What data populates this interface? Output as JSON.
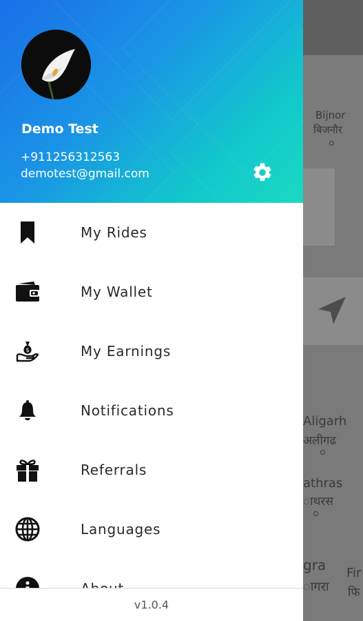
{
  "user": {
    "name": "Demo Test",
    "phone": "+911256312563",
    "email": "demotest@gmail.com"
  },
  "menu": {
    "items": [
      {
        "label": "My Rides",
        "icon": "bookmark-icon"
      },
      {
        "label": "My Wallet",
        "icon": "wallet-icon"
      },
      {
        "label": "My Earnings",
        "icon": "money-bag-hand-icon"
      },
      {
        "label": "Notifications",
        "icon": "bell-icon"
      },
      {
        "label": "Referrals",
        "icon": "gift-icon"
      },
      {
        "label": "Languages",
        "icon": "globe-icon"
      },
      {
        "label": "About",
        "icon": "info-icon"
      }
    ]
  },
  "footer": {
    "version": "v1.0.4"
  },
  "map": {
    "labels": {
      "bijnor_en": "Bijnor",
      "bijnor_hi": "बिजनौर",
      "aligarh_en": "Aligarh",
      "aligarh_hi": "अलीगढ",
      "hathras_en": "athras",
      "hathras_hi": "ाथरस",
      "agra_en": "gra",
      "agra_hi": "ागरा",
      "firozabad_en": "Fir",
      "firozabad_hi": "फि"
    }
  },
  "colors": {
    "header_gradient_start": "#1a6fe8",
    "header_gradient_end": "#1ad9c2",
    "overlay": "#6f6f6f"
  }
}
